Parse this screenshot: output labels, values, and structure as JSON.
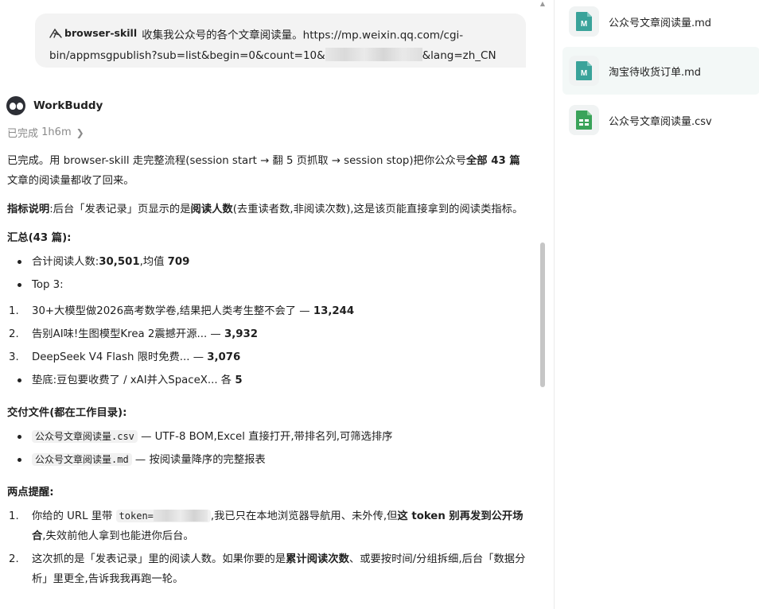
{
  "user_message": {
    "skill_tag": "browser-skill",
    "text_part1": "收集我公众号的各个文章阅读量。https://mp.weixin.qq.com/cgi-bin/appmsgpublish?sub=list&begin=0&count=10&",
    "text_part2": "&lang=zh_CN"
  },
  "agent": {
    "name": "WorkBuddy",
    "status": "已完成",
    "duration": "1h6m"
  },
  "message": {
    "intro_a": "已完成。用 browser-skill 走完整流程(session start → 翻 5 页抓取 → session stop)把你公众号",
    "intro_bold": "全部 43 篇",
    "intro_b": "文章的阅读量都收了回来。",
    "metric_label": "指标说明",
    "metric_a": ":后台「发表记录」页显示的是",
    "metric_bold": "阅读人数",
    "metric_b": "(去重读者数,非阅读次数),这是该页能直接拿到的阅读类指标。",
    "summary_title": "汇总",
    "summary_count": "(43 篇):",
    "total_label": "合计阅读人数:",
    "total_value": "30,501",
    "avg_label": ",均值 ",
    "avg_value": "709",
    "top3_label": "Top 3:",
    "top": [
      {
        "n": "1.",
        "title": "30+大模型做2026高考数学卷,结果把人类考生整不会了 — ",
        "value": "13,244"
      },
      {
        "n": "2.",
        "title": "告别AI味!生图模型Krea 2震撼开源... — ",
        "value": "3,932"
      },
      {
        "n": "3.",
        "title": "DeepSeek V4 Flash 限时免费... — ",
        "value": "3,076"
      }
    ],
    "bottom_label": "垫底:",
    "bottom_text": "豆包要收费了 / xAI并入SpaceX... 各 ",
    "bottom_value": "5",
    "deliver_title": "交付文件",
    "deliver_sub": "(都在工作目录):",
    "deliver": [
      {
        "file": "公众号文章阅读量.csv",
        "desc": " — UTF-8 BOM,Excel 直接打开,带排名列,可筛选排序"
      },
      {
        "file": "公众号文章阅读量.md",
        "desc": " — 按阅读量降序的完整报表"
      }
    ],
    "remind_title": "两点提醒",
    "remind_colon": ":",
    "r1_n": "1.",
    "r1_a": "你给的 URL 里带 ",
    "r1_code": "token=",
    "r1_b": ",我已只在本地浏览器导航用、未外传,但",
    "r1_bold": "这 token 别再发到公开场合",
    "r1_c": ",失效前他人拿到也能进你后台。",
    "r2_n": "2.",
    "r2_a": "这次抓的是「发表记录」里的阅读人数。如果你要的是",
    "r2_bold": "累计阅读次数",
    "r2_b": "、或要按时间/分组拆细,后台「数据分析」里更全,告诉我我再跑一轮。"
  },
  "files": [
    {
      "name": "公众号文章阅读量.md",
      "type": "md",
      "letter": "M"
    },
    {
      "name": "淘宝待收货订单.md",
      "type": "md",
      "letter": "M"
    },
    {
      "name": "公众号文章阅读量.csv",
      "type": "csv",
      "letter": ""
    }
  ],
  "colors": {
    "md_icon": "#3aa39a",
    "csv_icon": "#3aa35a",
    "active_bg": "#f3f8f7"
  }
}
